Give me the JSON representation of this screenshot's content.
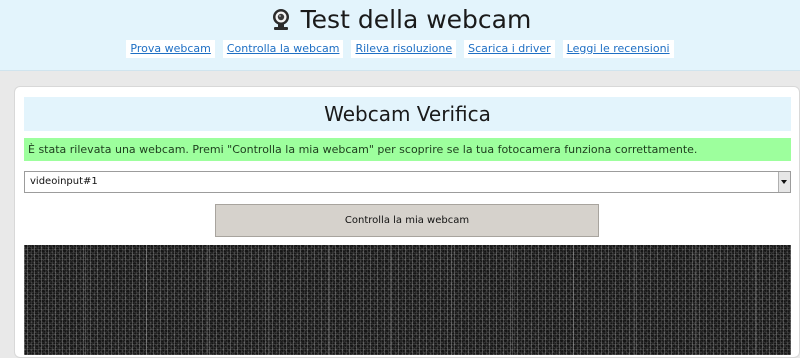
{
  "header": {
    "title": "Test della webcam",
    "title_icon": "webcam-icon",
    "background_color": "#e3f4fc",
    "nav": [
      {
        "label": "Prova webcam"
      },
      {
        "label": "Controlla la webcam"
      },
      {
        "label": "Rileva risoluzione"
      },
      {
        "label": "Scarica i driver"
      },
      {
        "label": "Leggi le recensioni"
      }
    ],
    "link_color": "#1e6fc4"
  },
  "main": {
    "title": "Webcam Verifica",
    "status_message": "È stata rilevata una webcam. Premi \"Controlla la mia webcam\" per scoprire se la tua fotocamera funziona correttamente.",
    "status_color": "#9dff9d",
    "device_select": {
      "selected": "videoinput#1"
    },
    "check_button_label": "Controlla la mia webcam",
    "video_preview": "noise"
  }
}
